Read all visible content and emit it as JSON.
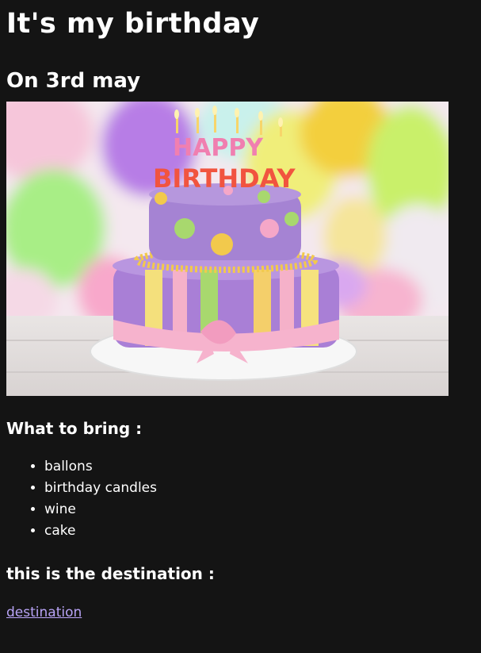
{
  "page": {
    "title": "It's my birthday",
    "subtitle": "On 3rd may"
  },
  "image": {
    "topper_line1": "HAPPY",
    "topper_line2": "BIRTHDAY"
  },
  "bring": {
    "heading": "What to bring :",
    "items": [
      "ballons",
      "birthday candles",
      "wine",
      "cake"
    ]
  },
  "destination": {
    "heading": "this is the destination :",
    "link_text": "destination"
  },
  "colors": {
    "background": "#141414",
    "text": "#ffffff",
    "link": "#b9a4f7"
  }
}
